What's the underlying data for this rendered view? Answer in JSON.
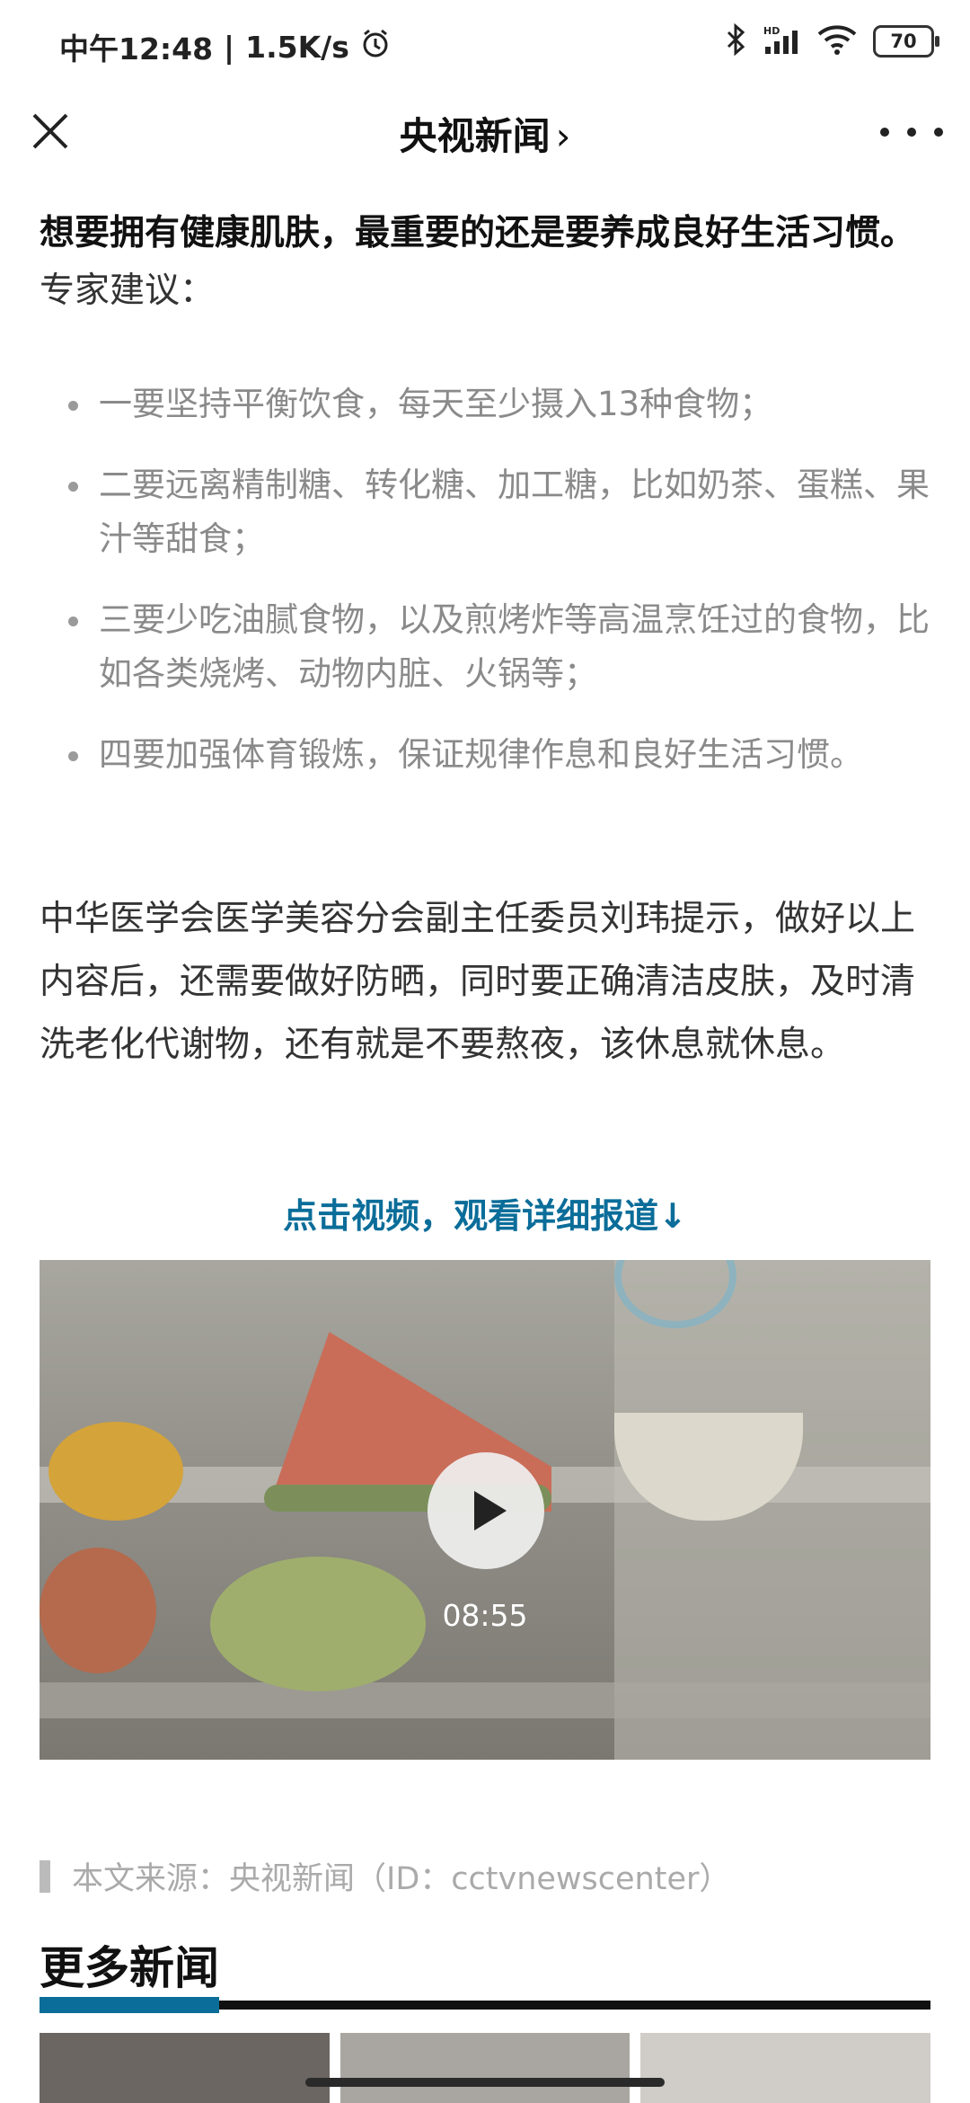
{
  "status": {
    "time": "中午12:48",
    "speed": "1.5K/s",
    "battery": "70"
  },
  "nav": {
    "title": "央视新闻",
    "chevron": "›"
  },
  "article": {
    "intro_bold": "想要拥有健康肌肤，最重要的还是要养成良好生活习惯。",
    "intro_rest": "专家建议：",
    "bullets": [
      "一要坚持平衡饮食，每天至少摄入13种食物；",
      "二要远离精制糖、转化糖、加工糖，比如奶茶、蛋糕、果汁等甜食；",
      "三要少吃油腻食物，以及煎烤炸等高温烹饪过的食物，比如各类烧烤、动物内脏、火锅等；",
      "四要加强体育锻炼，保证规律作息和良好生活习惯。"
    ],
    "paragraph2": "中华医学会医学美容分会副主任委员刘玮提示，做好以上内容后，还需要做好防晒，同时要正确清洁皮肤，及时清洗老化代谢物，还有就是不要熬夜，该休息就休息。",
    "video_link": "点击视频，观看详细报道↓",
    "video_duration": "08:55",
    "source": "本文来源：央视新闻（ID：cctvnewscenter）"
  },
  "more_news": {
    "heading": "更多新闻"
  },
  "colors": {
    "accent": "#0b6d99",
    "bullet_text": "#8a8a8a"
  }
}
